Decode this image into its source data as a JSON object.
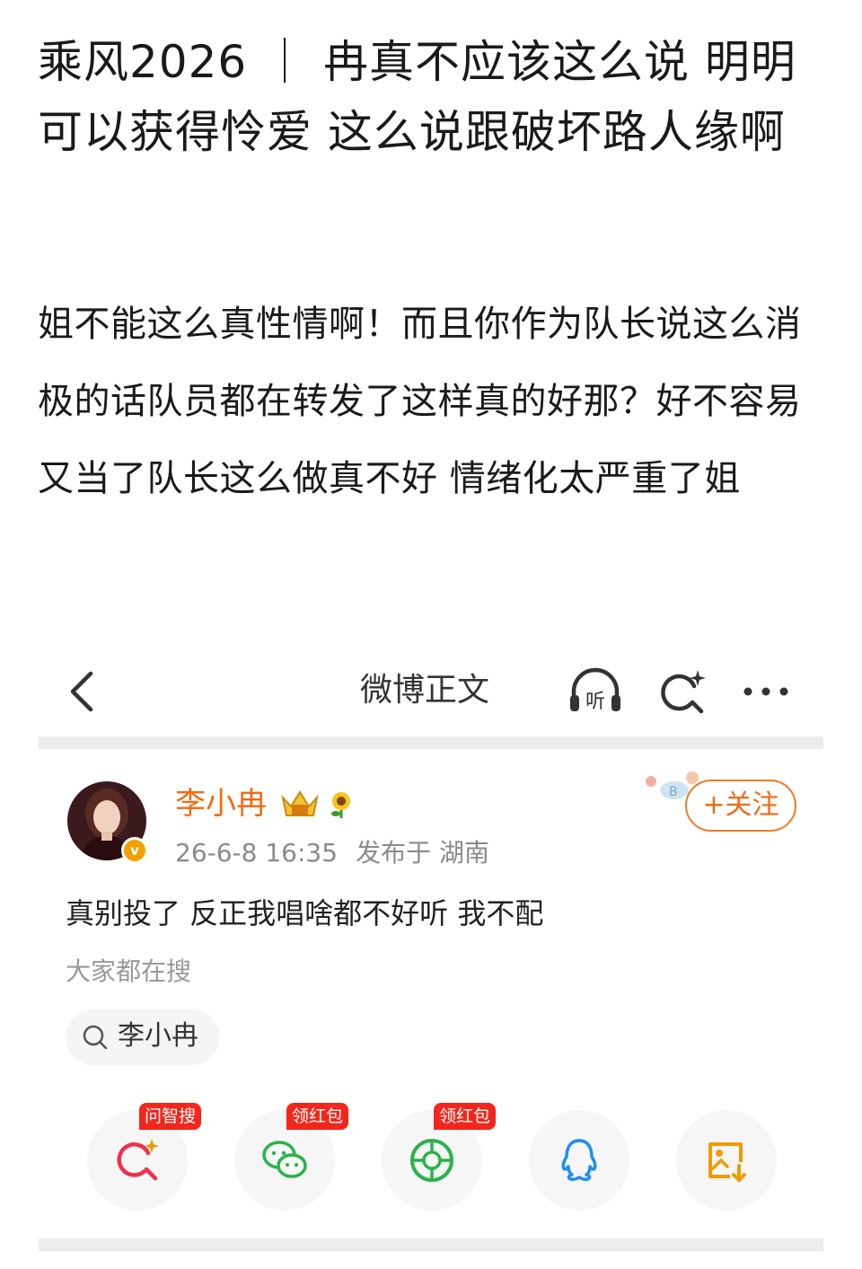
{
  "post": {
    "title": "乘风2026 ｜ 冉真不应该这么说 明明可以获得怜爱 这么说跟破坏路人缘啊",
    "body": "姐不能这么真性情啊！而且你作为队长说这么消极的话队员都在转发了这样真的好那？好不容易又当了队长这么做真不好 情绪化太严重了姐"
  },
  "embed": {
    "nav": {
      "title": "微博正文",
      "listen_label": "听",
      "icons": [
        "back-arrow-icon",
        "listen-icon",
        "ai-search-icon",
        "more-icon"
      ]
    },
    "user": {
      "name": "李小冉",
      "verified_mark": "v",
      "time": "26-6-8 16:35",
      "location": "发布于 湖南",
      "follow_label": "+关注"
    },
    "post_text": "真别投了 反正我唱啥都不好听 我不配",
    "search": {
      "label": "大家都在搜",
      "term": "李小冉"
    },
    "share": [
      {
        "icon": "ai-search-icon",
        "badge": "问智搜",
        "color": "#f0304a"
      },
      {
        "icon": "wechat-icon",
        "badge": "领红包",
        "color": "#2bb24c"
      },
      {
        "icon": "moments-icon",
        "badge": "领红包",
        "color": "#2bb24c"
      },
      {
        "icon": "qq-icon",
        "badge": "",
        "color": "#1e8ef0"
      },
      {
        "icon": "save-image-icon",
        "badge": "",
        "color": "#f29a00"
      }
    ],
    "colors": {
      "accent": "#f26a12",
      "badge": "#f4261b"
    }
  }
}
